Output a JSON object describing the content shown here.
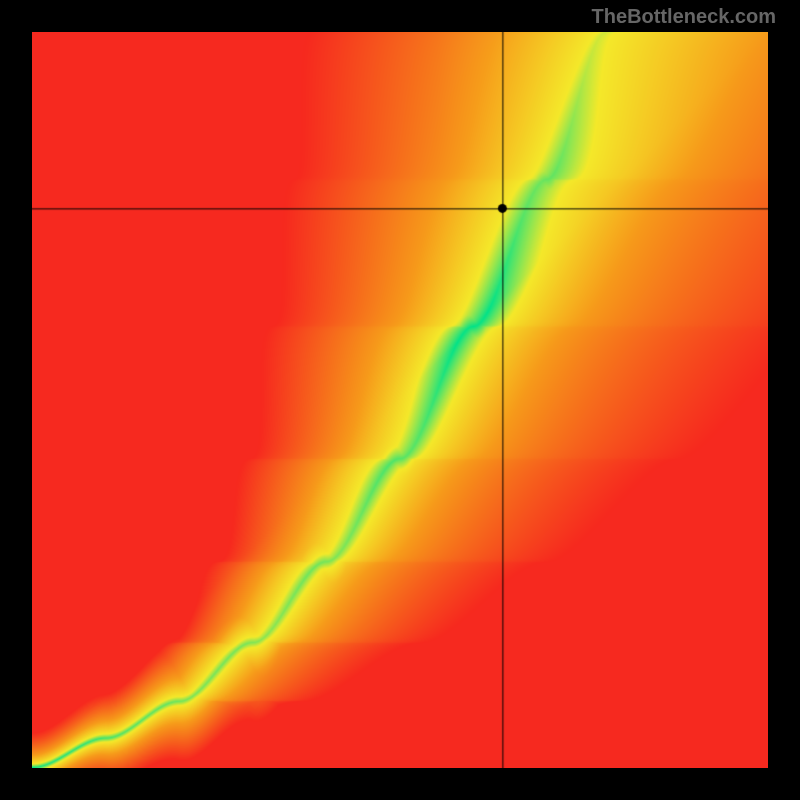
{
  "watermark": "TheBottleneck.com",
  "chart_data": {
    "type": "heatmap",
    "title": "",
    "xlabel": "",
    "ylabel": "",
    "xlim": [
      0,
      1
    ],
    "ylim": [
      0,
      1
    ],
    "crosshair": {
      "x": 0.64,
      "y": 0.76
    },
    "marker": {
      "x": 0.64,
      "y": 0.76
    },
    "ridge_curve": {
      "description": "Superlinear optimal curve from bottom-left to upper-right",
      "points": [
        {
          "x": 0.0,
          "y": 0.0
        },
        {
          "x": 0.1,
          "y": 0.04
        },
        {
          "x": 0.2,
          "y": 0.09
        },
        {
          "x": 0.3,
          "y": 0.17
        },
        {
          "x": 0.4,
          "y": 0.28
        },
        {
          "x": 0.5,
          "y": 0.42
        },
        {
          "x": 0.6,
          "y": 0.6
        },
        {
          "x": 0.7,
          "y": 0.8
        },
        {
          "x": 0.78,
          "y": 1.0
        }
      ]
    },
    "color_stops": {
      "ridge": "#00e28a",
      "near": "#f4e92a",
      "mid": "#f79a1a",
      "far": "#f6291f"
    },
    "band_width": {
      "at_origin": 0.01,
      "at_top": 0.12
    }
  }
}
